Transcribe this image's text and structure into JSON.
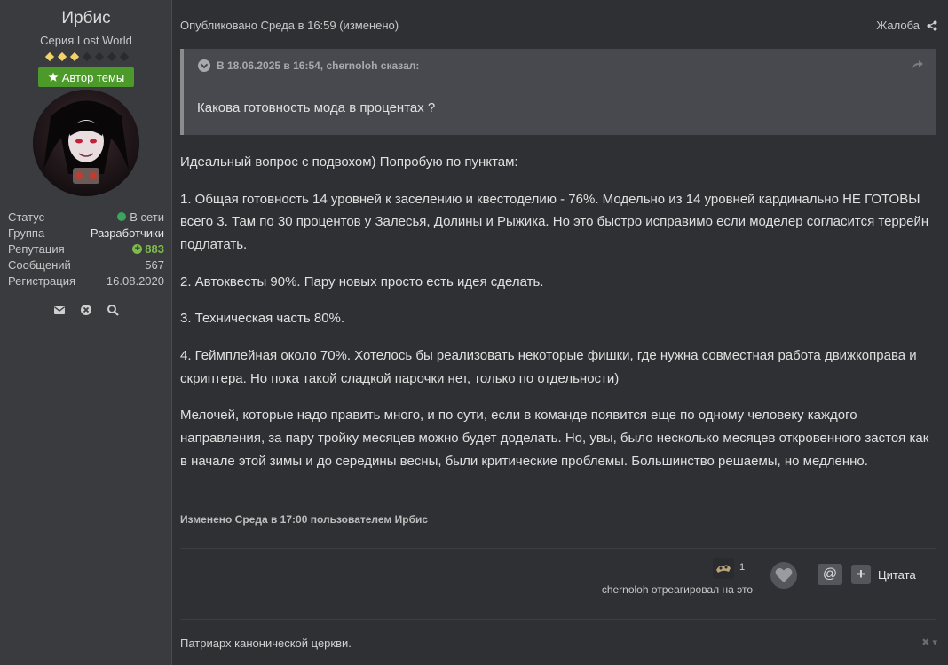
{
  "user": {
    "name": "Ирбис",
    "rank": "Серия Lost World",
    "rank_pips": {
      "filled": 3,
      "total": 7
    },
    "author_badge": "Автор темы",
    "stats": [
      {
        "label": "Статус",
        "value": "В сети"
      },
      {
        "label": "Группа",
        "value": "Разработчики"
      },
      {
        "label": "Репутация",
        "value": "883"
      },
      {
        "label": "Сообщений",
        "value": "567"
      },
      {
        "label": "Регистрация",
        "value": "16.08.2020"
      }
    ],
    "icons": [
      "envelope-icon",
      "block-icon",
      "search-icon"
    ]
  },
  "post": {
    "meta": "Опубликовано Среда в 16:59 (изменено)",
    "report_label": "Жалоба",
    "quote": {
      "header": "В 18.06.2025 в 16:54, chernoloh сказал:",
      "text": "Какова готовность мода в процентах ?"
    },
    "paragraphs": [
      "Идеальный вопрос с подвохом) Попробую по пунктам:",
      "1. Общая готовность 14 уровней к заселению и квестоделию - 76%. Модельно из 14 уровней кардинально НЕ ГОТОВЫ всего 3. Там по 30 процентов у Залесья, Долины и Рыжика. Но это быстро исправимо если моделер согласится террейн подлатать.",
      "2. Автоквесты 90%. Пару новых просто есть идея сделать.",
      "3. Техническая часть 80%.",
      "4. Геймплейная около 70%. Хотелось бы реализовать некоторые фишки, где нужна совместная работа движкоправа и скриптера. Но пока такой сладкой парочки нет, только по отдельности)",
      "Мелочей, которые надо править много, и по сути, если в команде появится еще по одному человеку каждого направления, за пару тройку месяцев можно будет доделать. Но, увы, было несколько месяцев откровенного застоя как в начале этой зимы и до середины весны, были критические проблемы. Большинство решаемы, но медленно."
    ],
    "edited_note": "Изменено Среда в 17:00 пользователем Ирбис",
    "reactions": {
      "count": "1",
      "text": "chernoloh отреагировал на это"
    },
    "buttons": {
      "mention": "@",
      "multiquote": "+",
      "quote": "Цитата"
    },
    "signature": "Патриарх канонической церкви."
  },
  "colors": {
    "background": "#2f3033",
    "sidebar": "#3a3b3f",
    "author_badge": "#4c9a2a",
    "online": "#3ea35c",
    "reputation": "#7dbb4a",
    "pips": "#f1d36a",
    "quote_bg": "#48494e"
  }
}
